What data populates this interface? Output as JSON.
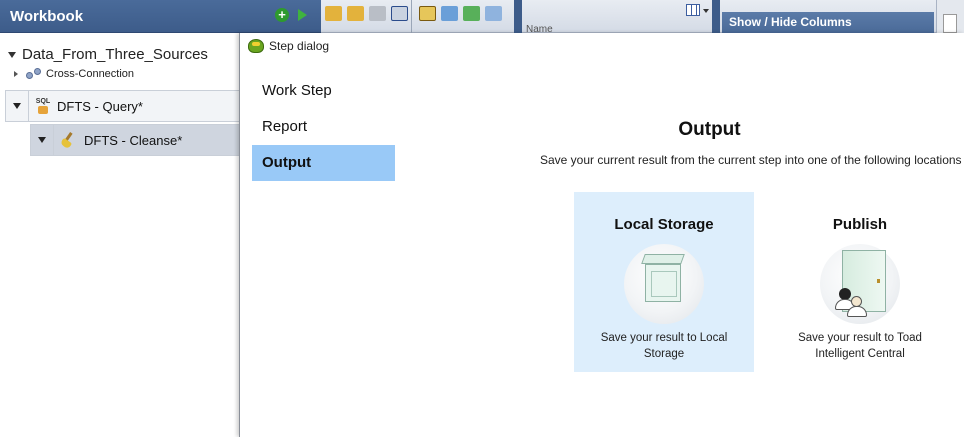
{
  "workbook": {
    "title": "Workbook",
    "tree": {
      "root_label": "Data_From_Three_Sources",
      "connection_label": "Cross-Connection",
      "steps": [
        {
          "label": "DFTS - Query*"
        },
        {
          "label": "DFTS - Cleanse*"
        }
      ]
    }
  },
  "background": {
    "panel_title": "Show / Hide Columns",
    "grid_header": "Name"
  },
  "dialog": {
    "title": "Step dialog",
    "nav": [
      {
        "label": "Work Step"
      },
      {
        "label": "Report"
      },
      {
        "label": "Output",
        "active": true
      }
    ],
    "output": {
      "heading": "Output",
      "description": "Save your current result from the current step into one of the following locations",
      "options": [
        {
          "title": "Local Storage",
          "text": "Save your result to Local Storage",
          "selected": true
        },
        {
          "title": "Publish",
          "text": "Save your result to Toad Intelligent Central",
          "selected": false
        }
      ]
    }
  },
  "colors": {
    "header_bg": "#3d5c8a",
    "nav_active_bg": "#99c9f7",
    "selected_option_bg": "#ddeefc"
  }
}
